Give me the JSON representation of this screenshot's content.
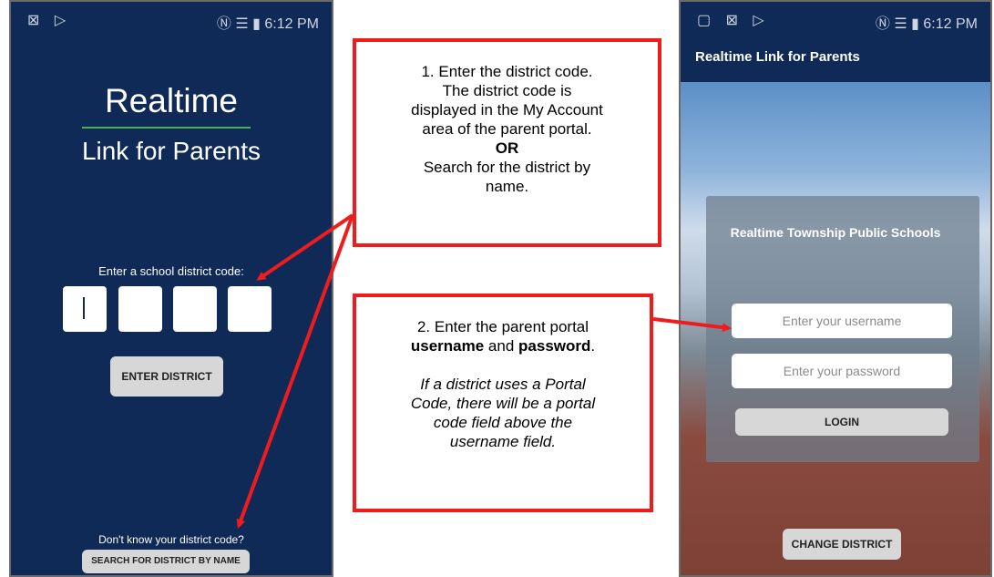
{
  "status_bar": {
    "left_icons": "⊠ ▷",
    "right_icons_time": "Ⓝ ☰ ▮ 6:12 PM"
  },
  "left_phone": {
    "logo_line1": "Realtime",
    "logo_line2": "Link for Parents",
    "prompt": "Enter a school district code:",
    "enter_button": "ENTER DISTRICT",
    "dont_know": "Don't know your district code?",
    "search_button": "SEARCH FOR DISTRICT BY NAME"
  },
  "callout1": {
    "line1": "1. Enter the district code.",
    "line2": "The district code is",
    "line3": "displayed in the My Account",
    "line4": "area of the parent portal.",
    "or": "OR",
    "line5": "Search for the district by",
    "line6": "name."
  },
  "callout2": {
    "line1": "2. Enter the parent portal",
    "username": "username",
    "and": "and",
    "password": "password",
    "period": ".",
    "italic1": "If a district uses a Portal",
    "italic2": "Code, there will be a portal",
    "italic3": "code field above the",
    "italic4": "username field."
  },
  "right_phone": {
    "app_title": "Realtime Link for Parents",
    "district_name": "Realtime Township Public Schools",
    "username_placeholder": "Enter your username",
    "password_placeholder": "Enter your password",
    "login_button": "LOGIN",
    "change_button": "CHANGE DISTRICT"
  },
  "colors": {
    "navy": "#0f2a57",
    "callout_red": "#ee1c1c",
    "button_gray": "#d7d7d7"
  }
}
